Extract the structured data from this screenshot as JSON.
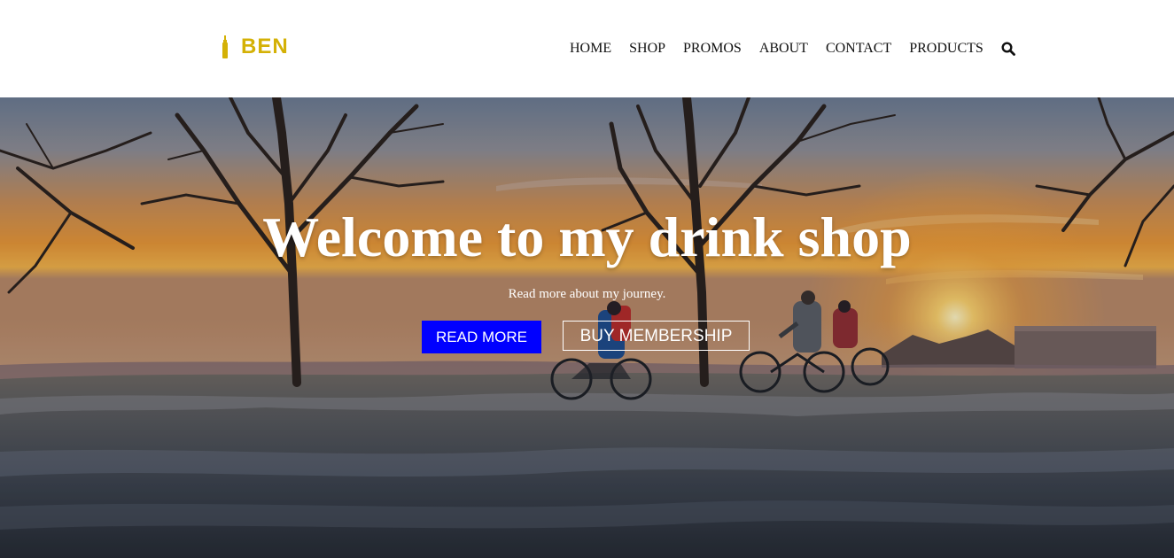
{
  "header": {
    "logo_text": "BEN",
    "logo_color": "#d4b106",
    "nav": [
      {
        "label": "HOME"
      },
      {
        "label": "SHOP"
      },
      {
        "label": "PROMOS"
      },
      {
        "label": "ABOUT"
      },
      {
        "label": "CONTACT"
      },
      {
        "label": "PRODUCTS"
      }
    ],
    "search_icon": "search-icon"
  },
  "hero": {
    "title": "Welcome to my drink shop",
    "subtitle": "Read more about my journey.",
    "primary_button": "READ MORE",
    "secondary_button": "BUY MEMBERSHIP",
    "primary_button_color": "#0000ff",
    "background": "sunset-cyclists-photo"
  }
}
